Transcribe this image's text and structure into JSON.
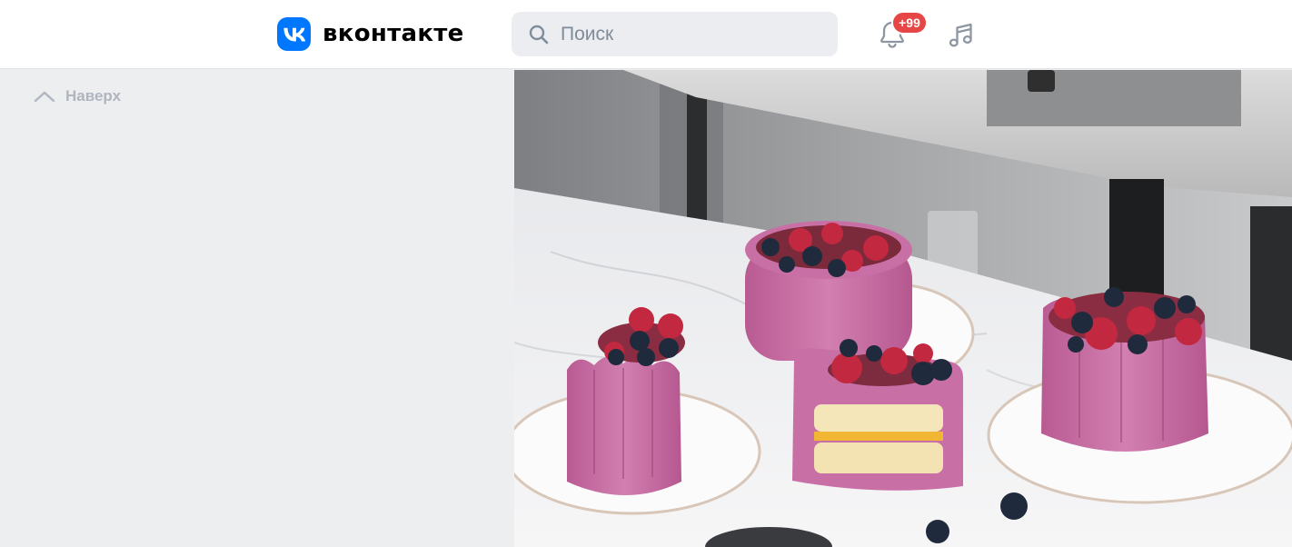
{
  "header": {
    "logo_text": "вконтакте",
    "search": {
      "placeholder": "Поиск"
    },
    "notifications": {
      "badge": "+99"
    }
  },
  "sidebar": {
    "scroll_top_label": "Наверх"
  },
  "colors": {
    "brand": "#0077ff",
    "badge": "#e64646",
    "page_background": "#edeef0",
    "cake_pink": "#c9679f"
  },
  "icons": [
    "vk-logo-icon",
    "search-icon",
    "bell-icon",
    "music-icon",
    "chevron-up-icon"
  ]
}
